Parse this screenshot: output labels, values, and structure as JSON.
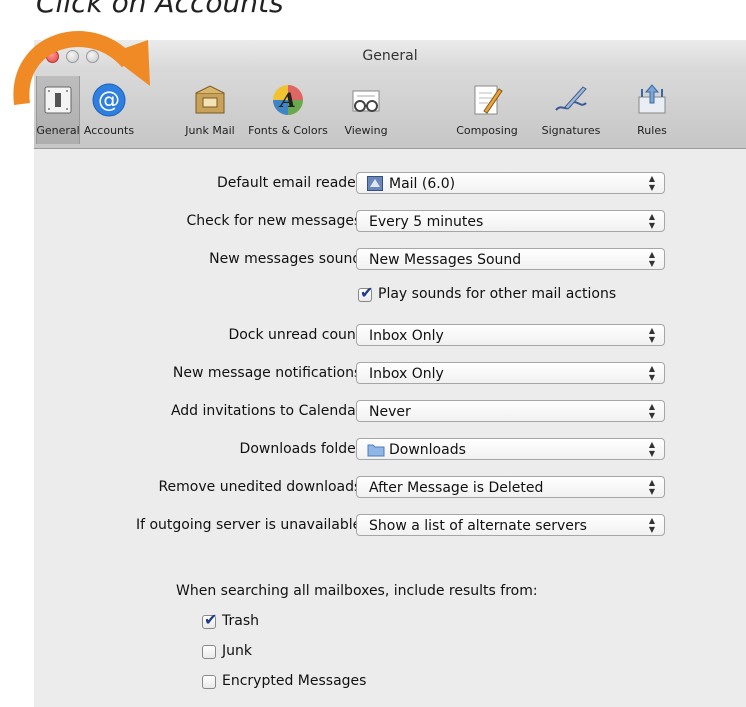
{
  "caption": "Click on Accounts",
  "window": {
    "title": "General"
  },
  "toolbar": [
    {
      "label": "General",
      "icon": "general-switch-icon",
      "selected": true
    },
    {
      "label": "Accounts",
      "icon": "at-sign-icon",
      "selected": false
    },
    {
      "label": "Junk Mail",
      "icon": "junk-mail-icon",
      "selected": false
    },
    {
      "label": "Fonts & Colors",
      "icon": "fonts-colors-icon",
      "selected": false
    },
    {
      "label": "Viewing",
      "icon": "viewing-glasses-icon",
      "selected": false
    },
    {
      "label": "Composing",
      "icon": "composing-pencil-icon",
      "selected": false
    },
    {
      "label": "Signatures",
      "icon": "signature-pen-icon",
      "selected": false
    },
    {
      "label": "Rules",
      "icon": "rules-arrows-icon",
      "selected": false
    }
  ],
  "settings": {
    "default_email_reader": {
      "label": "Default email reader:",
      "value": "Mail (6.0)"
    },
    "check_messages": {
      "label": "Check for new messages:",
      "value": "Every 5 minutes"
    },
    "new_messages_sound": {
      "label": "New messages sound:",
      "value": "New Messages Sound"
    },
    "play_sounds": {
      "label": "Play sounds for other mail actions",
      "checked": true
    },
    "dock_unread": {
      "label": "Dock unread count:",
      "value": "Inbox Only"
    },
    "notifications": {
      "label": "New message notifications:",
      "value": "Inbox Only"
    },
    "invitations": {
      "label": "Add invitations to Calendar:",
      "value": "Never"
    },
    "downloads_folder": {
      "label": "Downloads folder:",
      "value": "Downloads"
    },
    "remove_downloads": {
      "label": "Remove unedited downloads:",
      "value": "After Message is Deleted"
    },
    "outgoing_server": {
      "label": "If outgoing server is unavailable:",
      "value": "Show a list of alternate servers"
    }
  },
  "search": {
    "label": "When searching all mailboxes, include results from:",
    "trash": {
      "label": "Trash",
      "checked": true
    },
    "junk": {
      "label": "Junk",
      "checked": false
    },
    "encrypted": {
      "label": "Encrypted Messages",
      "checked": false
    }
  },
  "help": "?",
  "colors": {
    "arrow": "#f08a24",
    "accounts_icon": "#2f7fe0"
  }
}
